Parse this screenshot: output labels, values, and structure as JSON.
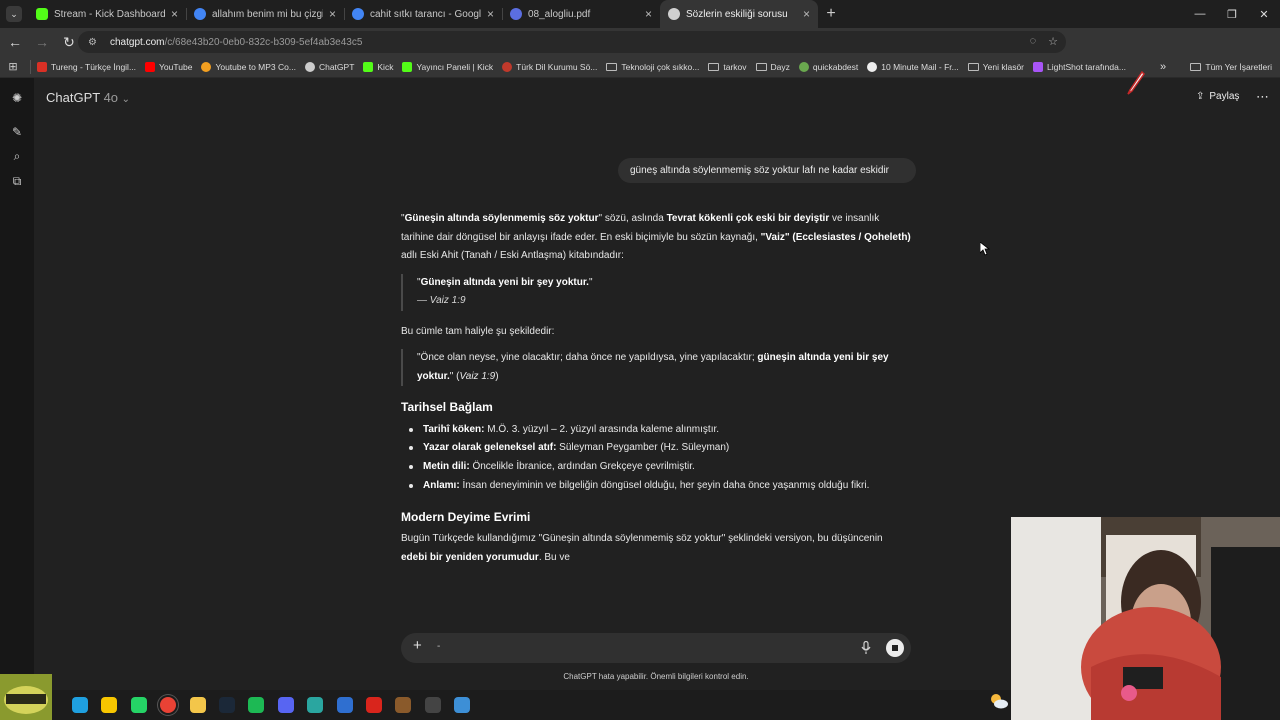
{
  "browser": {
    "tabs": [
      {
        "title": "Stream - Kick Dashboard",
        "color": "#53fc18"
      },
      {
        "title": "allahım benim mi bu çizgili yüz",
        "color": "#4285f4"
      },
      {
        "title": "cahit sıtkı tarancı - Google'da A",
        "color": "#4285f4"
      },
      {
        "title": "08_alogliu.pdf",
        "color": "#5b6ee1"
      },
      {
        "title": "Sözlerin eskiliği sorusu",
        "color": "#d0d0d0"
      }
    ],
    "address": {
      "host": "chatgpt.com",
      "path": "/c/68e43b20-0eb0-832c-b309-5ef4ab3e43c5"
    },
    "bookmarks": [
      {
        "label": "Tureng - Türkçe İngil...",
        "color": "#d93025"
      },
      {
        "label": "YouTube",
        "color": "#ff0000"
      },
      {
        "label": "Youtube to MP3 Co...",
        "color": "#f4a020"
      },
      {
        "label": "ChatGPT",
        "color": "#cccccc"
      },
      {
        "label": "Kick",
        "color": "#53fc18"
      },
      {
        "label": "Yayıncı Paneli | Kick",
        "color": "#53fc18"
      },
      {
        "label": "Türk Dil Kurumu Sö...",
        "color": "#c0392b"
      },
      {
        "label": "Teknoloji çok sıkko...",
        "folder": true
      },
      {
        "label": "tarkov",
        "folder": true
      },
      {
        "label": "Dayz",
        "folder": true
      },
      {
        "label": "quickabdest",
        "color": "#6aa84f"
      },
      {
        "label": "10 Minute Mail - Fr...",
        "color": "#eeeeee"
      },
      {
        "label": "Yeni klasör",
        "folder": true
      },
      {
        "label": "LightShot tarafında...",
        "color": "#a855f7"
      }
    ],
    "all_bookmarks": "Tüm Yer İşaretleri"
  },
  "chat": {
    "model_name": "ChatGPT",
    "model_version": "4o",
    "share_label": "Paylaş",
    "user_message": "güneş altında söylenmemiş söz yoktur lafı ne kadar eskidir",
    "p1": {
      "a": "\"",
      "b": "Güneşin altında söylenmemiş söz yoktur",
      "c": "\" sözü, aslında ",
      "d": "Tevrat kökenli çok eski bir deyiştir",
      "e": " ve insanlık tarihine dair döngüsel bir anlayışı ifade eder. En eski biçimiyle bu sözün kaynağı, ",
      "f": "\"Vaiz\" (Ecclesiastes / Qoheleth)",
      "g": " adlı Eski Ahit (Tanah / Eski Antlaşma) kitabındadır:"
    },
    "quote1": {
      "text": "Güneşin altında yeni bir şey yoktur.",
      "source": "— Vaiz 1:9"
    },
    "p2": "Bu cümle tam haliyle şu şekildedir:",
    "quote2": {
      "pre": "\"Önce olan neyse, yine olacaktır; daha önce ne yapıldıysa, yine yapılacaktır; ",
      "bold": "güneşin altında yeni bir şey yoktur.",
      "post": "\" (",
      "ref": "Vaiz 1:9",
      "end": ")"
    },
    "section1_title": "Tarihsel Bağlam",
    "bullets": [
      {
        "label": "Tarihî köken:",
        "text": " M.Ö. 3. yüzyıl – 2. yüzyıl arasında kaleme alınmıştır."
      },
      {
        "label": "Yazar olarak geleneksel atıf:",
        "text": " Süleyman Peygamber (Hz. Süleyman)"
      },
      {
        "label": "Metin dili:",
        "text": " Öncelikle İbranice, ardından Grekçeye çevrilmiştir."
      },
      {
        "label": "Anlamı:",
        "text": " İnsan deneyiminin ve bilgeliğin döngüsel olduğu, her şeyin daha önce yaşanmış olduğu fikri."
      }
    ],
    "section2_title": "Modern Deyime Evrimi",
    "p3": {
      "a": "Bugün Türkçede kullandığımız \"Güneşin altında söylenmemiş söz yoktur\" şeklindeki versiyon, bu düşüncenin ",
      "b": "edebi bir yeniden yorumudur",
      "c": ". Bu ve"
    },
    "composer_value": "-",
    "disclaimer": "ChatGPT hata yapabilir. Önemli bilgileri kontrol edin."
  },
  "taskbar": {
    "apps": [
      {
        "name": "edge",
        "color": "#1fa0e0"
      },
      {
        "name": "sticky-notes",
        "color": "#f7c600"
      },
      {
        "name": "whatsapp",
        "color": "#25d366"
      },
      {
        "name": "chrome",
        "color": "#e94235"
      },
      {
        "name": "file-explorer",
        "color": "#f3c64a"
      },
      {
        "name": "steam",
        "color": "#1b2838"
      },
      {
        "name": "spotify",
        "color": "#1db954"
      },
      {
        "name": "discord",
        "color": "#5865f2"
      },
      {
        "name": "app-teal",
        "color": "#2aa6a0"
      },
      {
        "name": "app-blue",
        "color": "#2f6fd0"
      },
      {
        "name": "acrobat",
        "color": "#d9251c"
      },
      {
        "name": "app-brown",
        "color": "#8a5a2b"
      },
      {
        "name": "obs",
        "color": "#444444"
      },
      {
        "name": "app-sky",
        "color": "#3d8fd6"
      }
    ]
  }
}
